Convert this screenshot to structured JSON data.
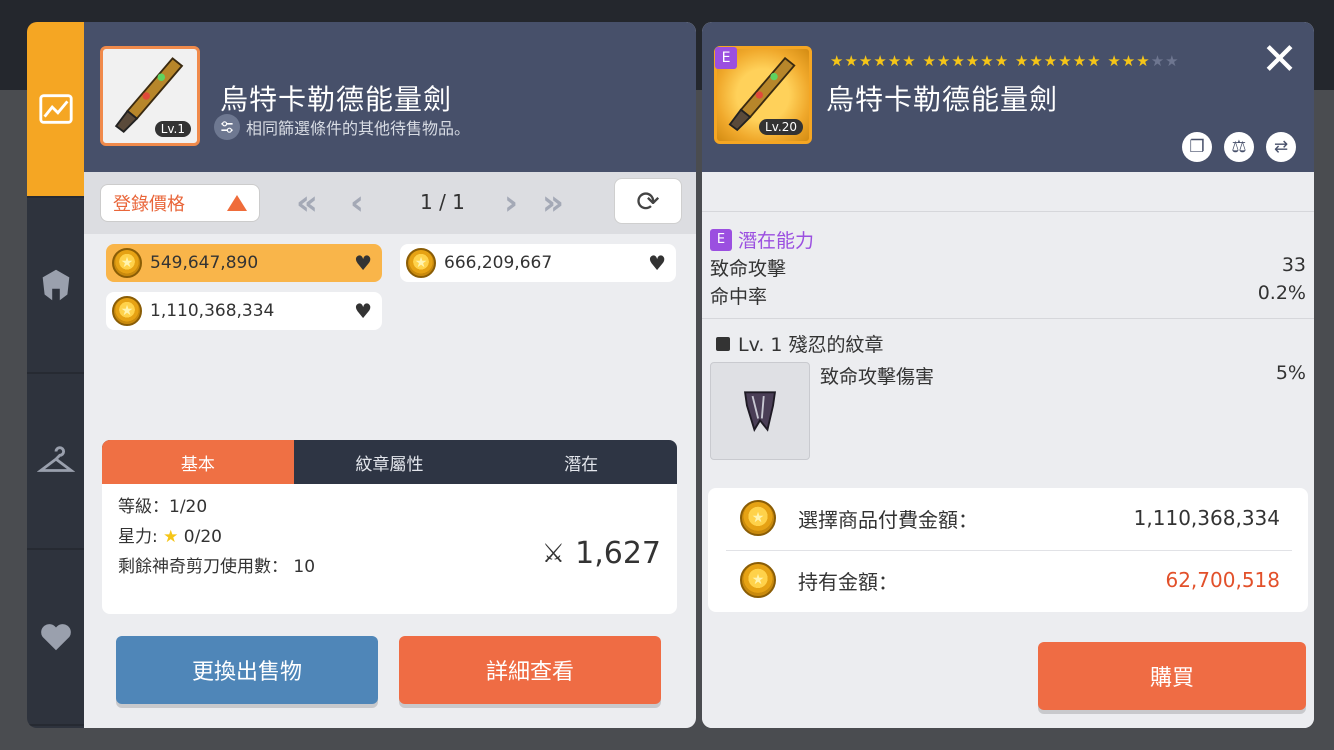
{
  "sidebar": {
    "tabs": [
      {
        "name": "chart-icon"
      },
      {
        "name": "helmet-icon"
      },
      {
        "name": "hanger-icon"
      },
      {
        "name": "heart-icon"
      }
    ]
  },
  "left": {
    "item_name": "烏特卡勒德能量劍",
    "item_level_badge": "Lv.1",
    "subtitle": "相同篩選條件的其他待售物品。",
    "sort_label": "登錄價格",
    "page_indicator": "1 / 1",
    "listings": [
      {
        "price": "549,647,890"
      },
      {
        "price": "666,209,667"
      },
      {
        "price": "1,110,368,334"
      }
    ],
    "tabs": [
      "基本",
      "紋章屬性",
      "潛在"
    ],
    "stats": {
      "level": "等級：1/20",
      "starforce_label": "星力:",
      "starforce_value": "0/20",
      "scissors": "剩餘神奇剪刀使用數： 10",
      "power": "1,627"
    },
    "buttons": {
      "change": "更換出售物",
      "detail": "詳細查看"
    }
  },
  "right": {
    "item_name": "烏特卡勒德能量劍",
    "item_level_badge": "Lv.20",
    "grade_badge": "E",
    "star_filled": "★★★★★★ ★★★★★★ ★★★★★★ ★★★",
    "star_empty": "★★",
    "potential_title": "潛在能力",
    "potential_badge": "E",
    "potential": [
      {
        "label": "致命攻擊",
        "value": "33"
      },
      {
        "label": "命中率",
        "value": "0.2%"
      }
    ],
    "emblem_title": "Lv. 1 殘忍的紋章",
    "emblem_stat": {
      "label": "致命攻擊傷害",
      "value": "5%"
    },
    "price_label": "選擇商品付費金額：",
    "price_value": "1,110,368,334",
    "owned_label": "持有金額：",
    "owned_value": "62,700,518",
    "buy": "購買",
    "close": "✕"
  },
  "colors": {
    "accent_orange": "#ef6c44",
    "tab_yellow": "#f5a623",
    "header": "#47506a",
    "purple": "#9b4fe0"
  }
}
